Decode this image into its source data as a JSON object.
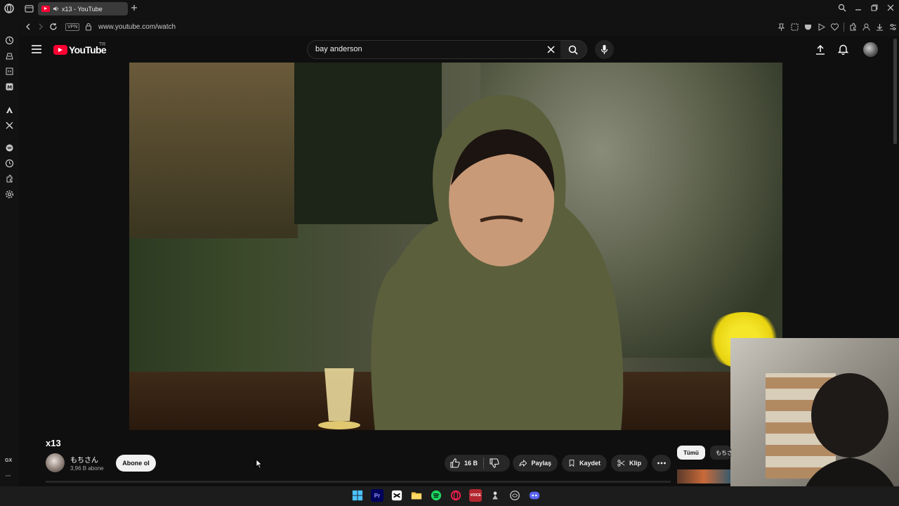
{
  "browser": {
    "tab_title": "x13 - YouTube",
    "vpn_label": "VPN",
    "url": "www.youtube.com/watch",
    "sidebar_gx_label": "GX",
    "sidebar_more_label": "···"
  },
  "youtube": {
    "logo_text": "YouTube",
    "region": "TR",
    "search_value": "bay anderson"
  },
  "video": {
    "title": "x13",
    "channel_name": "もちさん",
    "subscriber_count": "3,96 B abone",
    "subscribe_label": "Abone ol",
    "like_count": "16 B",
    "share_label": "Paylaş",
    "save_label": "Kaydet",
    "clip_label": "Klip"
  },
  "recommendation_chips": [
    "Tümü",
    "もちさん"
  ],
  "taskbar": {
    "items": [
      "start",
      "premiere",
      "capcut",
      "file-explorer",
      "spotify",
      "opera-gx",
      "voicemeeter",
      "app",
      "app",
      "discord"
    ],
    "premiere_label": "Pr",
    "voicemeeter_label": "VOICE"
  },
  "colors": {
    "youtube_red": "#ff0033",
    "background": "#0f0f0f",
    "pill": "#272727"
  }
}
